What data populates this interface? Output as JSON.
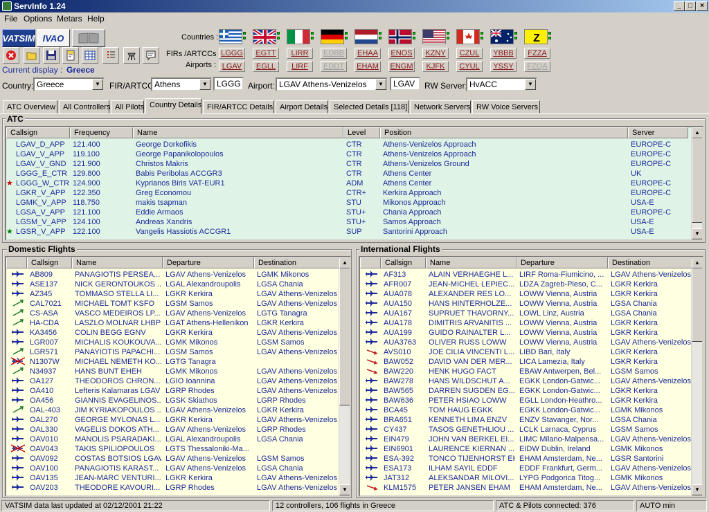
{
  "window": {
    "title": "ServInfo 1.24",
    "controls": [
      "_",
      "□",
      "×"
    ]
  },
  "menu": [
    {
      "label": "File",
      "u": "F"
    },
    {
      "label": "Options",
      "u": "O"
    },
    {
      "label": "Metars",
      "u": "M"
    },
    {
      "label": "Help",
      "u": "H"
    }
  ],
  "networks": {
    "vatsim": "VATSIM",
    "ivao": "IVAO"
  },
  "current_display": {
    "label": "Current display :",
    "value": "Greece"
  },
  "labels": {
    "countries": "Countries :",
    "firs": "FIRs /ARTCCs :",
    "airports": "Airports :"
  },
  "flags": [
    {
      "country": "greece",
      "fir": "LGGG",
      "airport": "LGAV",
      "fir_enabled": true,
      "apt_enabled": true
    },
    {
      "country": "uk",
      "fir": "EGTT",
      "airport": "EGLL",
      "fir_enabled": true,
      "apt_enabled": true
    },
    {
      "country": "italy",
      "fir": "LIRR",
      "airport": "LIRF",
      "fir_enabled": true,
      "apt_enabled": true
    },
    {
      "country": "germany",
      "fir": "EDBB",
      "airport": "EDDT",
      "fir_enabled": false,
      "apt_enabled": false
    },
    {
      "country": "netherlands",
      "fir": "EHAA",
      "airport": "EHAM",
      "fir_enabled": true,
      "apt_enabled": true
    },
    {
      "country": "norway",
      "fir": "ENOS",
      "airport": "ENGM",
      "fir_enabled": true,
      "apt_enabled": true
    },
    {
      "country": "usa",
      "fir": "KZNY",
      "airport": "KJFK",
      "fir_enabled": true,
      "apt_enabled": true
    },
    {
      "country": "canada",
      "fir": "CZUL",
      "airport": "CYUL",
      "fir_enabled": true,
      "apt_enabled": true
    },
    {
      "country": "australia",
      "fir": "YBBB",
      "airport": "YSSY",
      "fir_enabled": true,
      "apt_enabled": true
    },
    {
      "country": "z",
      "fir": "FZZA",
      "airport": "FZQA",
      "fir_enabled": true,
      "apt_enabled": false
    }
  ],
  "filters": {
    "country_label": "Country:",
    "country": "Greece",
    "fir_label": "FIR/ARTCC:",
    "fir": "Athens",
    "fir_code": "LGGG",
    "airport_label": "Airport:",
    "airport": "LGAV Athens-Venizelos",
    "airport_code": "LGAV",
    "rw_label": "RW Server:",
    "rw_server": "HvACC"
  },
  "tabs": [
    "ATC Overview",
    "All Controllers",
    "All Pilots",
    "Country Details",
    "FIR/ARTCC Details",
    "Airport Details",
    "Selected Details [118]",
    "Network Servers",
    "RW Voice Servers"
  ],
  "active_tab": 3,
  "atc": {
    "title": "ATC",
    "headers": [
      "Callsign",
      "Frequency",
      "Name",
      "Level",
      "Position",
      "Server"
    ],
    "rows": [
      {
        "mark": "",
        "c": [
          "LGAV_D_APP",
          "121.400",
          "George Dorkofikis",
          "CTR",
          "Athens-Venizelos Approach",
          "EUROPE-C"
        ]
      },
      {
        "mark": "",
        "c": [
          "LGAV_V_APP",
          "119.100",
          "George Papanikolopoulos",
          "CTR",
          "Athens-Venizelos Approach",
          "EUROPE-C"
        ]
      },
      {
        "mark": "",
        "c": [
          "LGAV_V_GND",
          "121.900",
          "Christos Makris",
          "CTR",
          "Athens-Venizelos Ground",
          "EUROPE-C"
        ]
      },
      {
        "mark": "",
        "c": [
          "LGGG_E_CTR",
          "129.800",
          "Babis Peribolas ACCGR3",
          "CTR",
          "Athens Center",
          "UK"
        ]
      },
      {
        "mark": "red",
        "c": [
          "LGGG_W_CTR",
          "124.900",
          "Kyprianos Biris VAT-EUR1",
          "ADM",
          "Athens Center",
          "EUROPE-C"
        ]
      },
      {
        "mark": "",
        "c": [
          "LGKR_V_APP",
          "122.350",
          "Greg Economou",
          "CTR+",
          "Kerkira Approach",
          "EUROPE-C"
        ]
      },
      {
        "mark": "",
        "c": [
          "LGMK_V_APP",
          "118.750",
          "makis tsapman",
          "STU",
          "Mikonos Approach",
          "USA-E"
        ]
      },
      {
        "mark": "",
        "c": [
          "LGSA_V_APP",
          "121.100",
          "Eddie Armaos",
          "STU+",
          "Chania Approach",
          "EUROPE-C"
        ]
      },
      {
        "mark": "",
        "c": [
          "LGSM_V_APP",
          "124.100",
          "Andreas Xandris",
          "STU+",
          "Samos Approach",
          "USA-E"
        ]
      },
      {
        "mark": "green",
        "c": [
          "LGSR_V_APP",
          "122.100",
          "Vangelis Hassiotis ACCGR1",
          "SUP",
          "Santorini Approach",
          "USA-E"
        ]
      }
    ]
  },
  "domestic": {
    "title": "Domestic Flights",
    "headers": [
      "Callsign",
      "Name",
      "Departure",
      "Destination"
    ],
    "rows": [
      {
        "i": "jet",
        "c": [
          "AB809",
          "PANAGIOTIS PERSEA...",
          "LGAV Athens-Venizelos",
          "LGMK Mikonos"
        ]
      },
      {
        "i": "jet",
        "c": [
          "ASE137",
          "NICK GERONTOUKOS ...",
          "LGAL Alexandroupolis",
          "LGSA Chania"
        ]
      },
      {
        "i": "jet",
        "c": [
          "AZ345",
          "TOMMASO STELLA LI...",
          "LGKR Kerkira",
          "LGAV Athens-Venizelos"
        ]
      },
      {
        "i": "prop",
        "c": [
          "CAL7021",
          "MICHAEL TOMT KSFO",
          "LGSM Samos",
          "LGAV Athens-Venizelos"
        ]
      },
      {
        "i": "prop",
        "c": [
          "CS-ASA",
          "VASCO MEDEIROS LP...",
          "LGAV Athens-Venizelos",
          "LGTG Tanagra"
        ]
      },
      {
        "i": "prop",
        "c": [
          "HA-CDA",
          "LASZLO MOLNAR LHBP",
          "LGAT Athens-Hellenikon",
          "LGKR Kerkira"
        ]
      },
      {
        "i": "jet",
        "c": [
          "KA3456",
          "COLIN BEGG EGNV",
          "LGKR Kerkira",
          "LGAV Athens-Venizelos"
        ]
      },
      {
        "i": "jet",
        "c": [
          "LGR007",
          "MICHALIS KOUKOUVA...",
          "LGMK Mikonos",
          "LGSM Samos"
        ]
      },
      {
        "i": "prop",
        "c": [
          "LGR571",
          "PANAYIOTIS PAPACHI...",
          "LGSM Samos",
          "LGAV Athens-Venizelos"
        ]
      },
      {
        "i": "x",
        "c": [
          "N1307W",
          "MICHAEL NEMETH KO...",
          "LGTG Tanagra",
          ""
        ]
      },
      {
        "i": "prop",
        "c": [
          "N34937",
          "HANS BUNT EHEH",
          "LGMK Mikonos",
          "LGAV Athens-Venizelos"
        ]
      },
      {
        "i": "jet",
        "c": [
          "OA127",
          "THEODOROS CHRON...",
          "LGIO Ioannina",
          "LGAV Athens-Venizelos"
        ]
      },
      {
        "i": "jet",
        "c": [
          "OA410",
          "Lefteris Kalamaras LGAV",
          "LGRP Rhodes",
          "LGAV Athens-Venizelos"
        ]
      },
      {
        "i": "jet",
        "c": [
          "OA456",
          "GIANNIS EVAGELINOS...",
          "LGSK Skiathos",
          "LGRP Rhodes"
        ]
      },
      {
        "i": "prop",
        "c": [
          "OAL-403",
          "JIM KYRIAKOPOULOS ...",
          "LGAV Athens-Venizelos",
          "LGKR Kerkira"
        ]
      },
      {
        "i": "jet",
        "c": [
          "OAL270",
          "GEORGE MYLONAS L...",
          "LGKR Kerkira",
          "LGAV Athens-Venizelos"
        ]
      },
      {
        "i": "jet",
        "c": [
          "OAL330",
          "VAGELIS DOKOS ATH...",
          "LGAV Athens-Venizelos",
          "LGRP Rhodes"
        ]
      },
      {
        "i": "jet",
        "c": [
          "OAV010",
          "MANOLIS PSARADAKI...",
          "LGAL Alexandroupolis",
          "LGSA Chania"
        ]
      },
      {
        "i": "x",
        "c": [
          "OAV043",
          "TAKIS SPILIOPOULOS",
          "LGTS Thessaloniki-Ma...",
          ""
        ]
      },
      {
        "i": "jet",
        "c": [
          "OAV092",
          "COSTAS BOTSIOS LGAV",
          "LGAV Athens-Venizelos",
          "LGSM Samos"
        ]
      },
      {
        "i": "jet",
        "c": [
          "OAV100",
          "PANAGIOTIS KARAST...",
          "LGAV Athens-Venizelos",
          "LGSA Chania"
        ]
      },
      {
        "i": "jet",
        "c": [
          "OAV135",
          "JEAN-MARC VENTURI...",
          "LGKR Kerkira",
          "LGAV Athens-Venizelos"
        ]
      },
      {
        "i": "jet",
        "c": [
          "OAV203",
          "THEODORE KAVOURI...",
          "LGRP Rhodes",
          "LGAV Athens-Venizelos"
        ]
      }
    ]
  },
  "international": {
    "title": "International Flights",
    "headers": [
      "Callsign",
      "Name",
      "Departure",
      "Destination"
    ],
    "rows": [
      {
        "i": "jet",
        "c": [
          "AF313",
          "ALAIN VERHAEGHE L...",
          "LIRF Roma-Fiumicino, ...",
          "LGAV Athens-Venizelos"
        ]
      },
      {
        "i": "jet",
        "c": [
          "AFR007",
          "JEAN-MICHEL LEPIEC...",
          "LDZA Zagreb-Pleso, C...",
          "LGKR Kerkira"
        ]
      },
      {
        "i": "jet",
        "c": [
          "AUA078",
          "ALEXANDER RES LO...",
          "LOWW Vienna, Austria",
          "LGKR Kerkira"
        ]
      },
      {
        "i": "jet",
        "c": [
          "AUA150",
          "HANS HINTERHOLZE...",
          "LOWW Vienna, Austria",
          "LGSA Chania"
        ]
      },
      {
        "i": "jet",
        "c": [
          "AUA167",
          "SUPRUET THAVORNY...",
          "LOWL Linz, Austria",
          "LGSA Chania"
        ]
      },
      {
        "i": "jet",
        "c": [
          "AUA178",
          "DIMITRIS ARVANITIS ...",
          "LOWW Vienna, Austria",
          "LGKR Kerkira"
        ]
      },
      {
        "i": "jet",
        "c": [
          "AUA199",
          "GUIDO RAINALTER L...",
          "LOWW Vienna, Austria",
          "LGKR Kerkira"
        ]
      },
      {
        "i": "jet",
        "c": [
          "AUA3763",
          "OLIVER RUSS LOWW",
          "LOWW Vienna, Austria",
          "LGAV Athens-Venizelos"
        ]
      },
      {
        "i": "dep",
        "c": [
          "AVS010",
          "JOE CILIA VINCENTI L...",
          "LIBD Bari, Italy",
          "LGKR Kerkira"
        ]
      },
      {
        "i": "dep",
        "c": [
          "BAW052",
          "DAVID VAN DER MER...",
          "LICA Lamezia, Italy",
          "LGKR Kerkira"
        ]
      },
      {
        "i": "dep",
        "c": [
          "BAW220",
          "HENK HUGO FACT",
          "EBAW Antwerpen, Bel...",
          "LGSM Samos"
        ]
      },
      {
        "i": "jet",
        "c": [
          "BAW278",
          "HANS WILDSCHUT A...",
          "EGKK London-Gatwic...",
          "LGAV Athens-Venizelos"
        ]
      },
      {
        "i": "jet",
        "c": [
          "BAW565",
          "DARREN SUGDEN EG...",
          "EGKK London-Gatwic...",
          "LGKR Kerkira"
        ]
      },
      {
        "i": "jet",
        "c": [
          "BAW636",
          "PETER HSIAO LOWW",
          "EGLL London-Heathro...",
          "LGKR Kerkira"
        ]
      },
      {
        "i": "jet",
        "c": [
          "BCA45",
          "TOM HAUG EGKK",
          "EGKK London-Gatwic...",
          "LGMK Mikonos"
        ]
      },
      {
        "i": "jet",
        "c": [
          "BRA651",
          "KENNETH LIMA ENZV",
          "ENZV Stavanger, Nor...",
          "LGSA Chania"
        ]
      },
      {
        "i": "jet",
        "c": [
          "CY437",
          "TASOS GENETHLIOU ...",
          "LCLK Larnaca, Cyprus",
          "LGSM Samos"
        ]
      },
      {
        "i": "jet",
        "c": [
          "EIN479",
          "JOHN VAN BERKEL EI...",
          "LIMC Milano-Malpensa...",
          "LGAV Athens-Venizelos"
        ]
      },
      {
        "i": "jet",
        "c": [
          "EIN6901",
          "LAURENCE KIERNAN ...",
          "EIDW Dublin, Ireland",
          "LGMK Mikonos"
        ]
      },
      {
        "i": "jet",
        "c": [
          "ESA-392",
          "TONCO TIJENHORST EH...",
          "EHAM Amsterdam, Ne...",
          "LGSR Santorini"
        ]
      },
      {
        "i": "jet",
        "c": [
          "ESA173",
          "ILHAM SAYIL EDDF",
          "EDDF Frankfurt, Germ...",
          "LGAV Athens-Venizelos"
        ]
      },
      {
        "i": "jet",
        "c": [
          "JAT312",
          "ALEKSANDAR MILOVI...",
          "LYPG Podgorica Titog...",
          "LGMK Mikonos"
        ]
      },
      {
        "i": "dep",
        "c": [
          "KLM1575",
          "PETER JANSEN EHAM",
          "EHAM Amsterdam, Ne...",
          "LGAV Athens-Venizelos"
        ]
      }
    ]
  },
  "status": {
    "updated": "VATSIM data last updated at 02/12/2001 21:22",
    "summary": "12 controllers, 106 flights in Greece",
    "connected": "ATC & Pilots connected: 376",
    "auto": "AUTO min"
  }
}
